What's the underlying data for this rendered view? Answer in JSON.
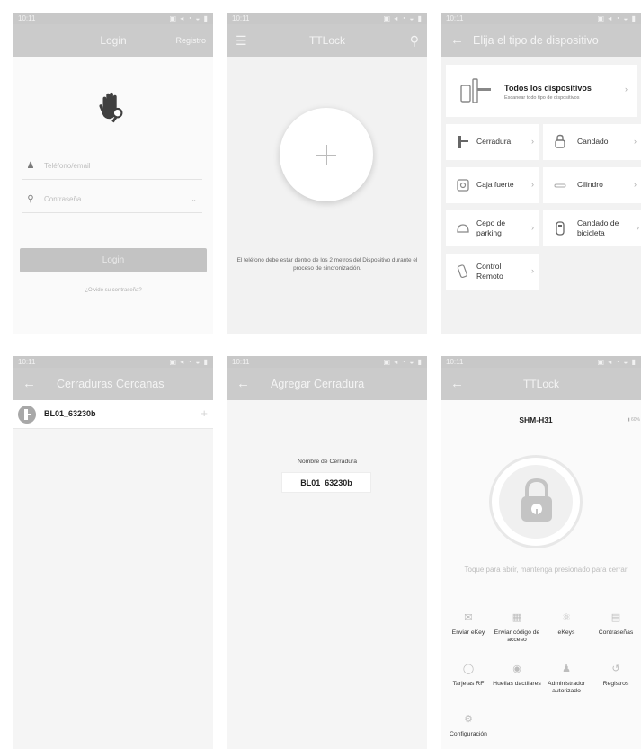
{
  "statusbar": {
    "time": "10:11",
    "icons": "▣ ◂ ◔ ◒ ▮"
  },
  "screen_login": {
    "title": "Login",
    "register": "Registro",
    "phone_placeholder": "Teléfono/email",
    "password_placeholder": "Contraseña",
    "login_button": "Login",
    "forgot": "¿Olvidó su contraseña?"
  },
  "screen_home": {
    "title": "TTLock",
    "hint": "El teléfono debe estar dentro de los 2 metros del Dispositivo durante el proceso de sincronización."
  },
  "screen_device_type": {
    "title": "Elija el tipo de dispositivo",
    "all_title": "Todos los dispositivos",
    "all_sub": "Escanear todo tipo de dispositivos",
    "items": [
      {
        "label": "Cerradura"
      },
      {
        "label": "Candado"
      },
      {
        "label": "Caja fuerte"
      },
      {
        "label": "Cilindro"
      },
      {
        "label": "Cepo de parking"
      },
      {
        "label": "Candado de bicicleta"
      },
      {
        "label": "Control Remoto"
      }
    ]
  },
  "screen_nearby": {
    "title": "Cerraduras Cercanas",
    "lock_id": "BL01_63230b"
  },
  "screen_add_lock": {
    "title": "Agregar Cerradura",
    "name_label": "Nombre de Cerradura",
    "name_value": "BL01_63230b"
  },
  "screen_lock": {
    "title": "TTLock",
    "lock_name": "SHM-H31",
    "battery": "▮ 60%",
    "hint": "Toque para abrir, mantenga presionado para cerrar",
    "functions": [
      {
        "label": "Enviar eKey",
        "icon": "send-ekey-icon"
      },
      {
        "label": "Enviar código de acceso",
        "icon": "passcode-icon"
      },
      {
        "label": "eKeys",
        "icon": "ekeys-icon"
      },
      {
        "label": "Contraseñas",
        "icon": "passwords-icon"
      },
      {
        "label": "Tarjetas RF",
        "icon": "rf-card-icon"
      },
      {
        "label": "Huellas dactilares",
        "icon": "fingerprint-icon"
      },
      {
        "label": "Administrador autorizado",
        "icon": "admin-icon"
      },
      {
        "label": "Registros",
        "icon": "records-icon"
      },
      {
        "label": "Configuración",
        "icon": "settings-icon"
      }
    ]
  },
  "colors": {
    "appbar": "#cbcbcb",
    "statusbar": "#c8c8c8",
    "login_button": "#c3c3c3",
    "background": "#f2f2f2"
  }
}
